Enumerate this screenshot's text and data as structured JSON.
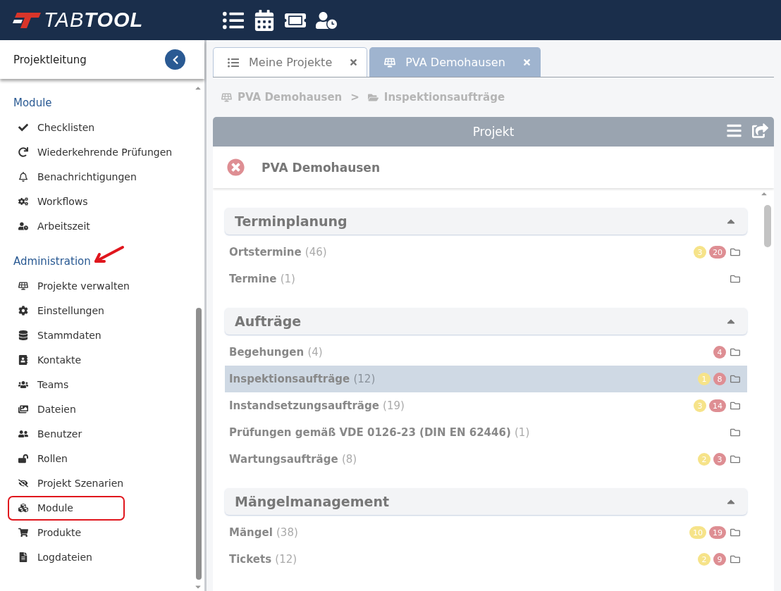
{
  "header": {
    "logo": "TAB**TOOL**"
  },
  "sidebar": {
    "title": "Projektleitung",
    "sections": [
      {
        "title": "Module",
        "annotation_arrow": false,
        "items": [
          {
            "label": "Checklisten",
            "highlighted": false
          },
          {
            "label": "Wiederkehrende Prüfungen",
            "highlighted": false
          },
          {
            "label": "Benachrichtigungen",
            "highlighted": false
          },
          {
            "label": "Workflows",
            "highlighted": false
          },
          {
            "label": "Arbeitszeit",
            "highlighted": false
          }
        ]
      },
      {
        "title": "Administration",
        "annotation_arrow": true,
        "items": [
          {
            "label": "Projekte verwalten",
            "highlighted": false
          },
          {
            "label": "Einstellungen",
            "highlighted": false
          },
          {
            "label": "Stammdaten",
            "highlighted": false
          },
          {
            "label": "Kontakte",
            "highlighted": false
          },
          {
            "label": "Teams",
            "highlighted": false
          },
          {
            "label": "Dateien",
            "highlighted": false
          },
          {
            "label": "Benutzer",
            "highlighted": false
          },
          {
            "label": "Rollen",
            "highlighted": false
          },
          {
            "label": "Projekt Szenarien",
            "highlighted": false
          },
          {
            "label": "Module",
            "highlighted": true
          },
          {
            "label": "Produkte",
            "highlighted": false
          },
          {
            "label": "Logdateien",
            "highlighted": false
          }
        ]
      }
    ]
  },
  "tabs": [
    {
      "label": "Meine Projekte",
      "selected": false
    },
    {
      "label": "PVA Demohausen",
      "selected": true
    }
  ],
  "breadcrumb": [
    "PVA Demohausen",
    "Inspektionsaufträge"
  ],
  "breadcrumb_separator": ">",
  "panel": {
    "title": "Projekt",
    "project_name": "PVA Demohausen",
    "sections": [
      {
        "title": "Terminplanung",
        "expanded": true,
        "rows": [
          {
            "name": "Ortstermine",
            "count": "(46)",
            "selected": false,
            "badges": [
              {
                "text": "3",
                "color": "#f6e389"
              },
              {
                "text": "20",
                "color": "#de8e93"
              }
            ]
          },
          {
            "name": "Termine",
            "count": "(1)",
            "selected": false,
            "badges": []
          }
        ]
      },
      {
        "title": "Aufträge",
        "expanded": true,
        "rows": [
          {
            "name": "Begehungen",
            "count": "(4)",
            "selected": false,
            "badges": [
              {
                "text": "4",
                "color": "#de8e93"
              }
            ]
          },
          {
            "name": "Inspektionsaufträge",
            "count": "(12)",
            "selected": true,
            "badges": [
              {
                "text": "1",
                "color": "#f6e389"
              },
              {
                "text": "8",
                "color": "#de8e93"
              }
            ]
          },
          {
            "name": "Instandsetzungsaufträge",
            "count": "(19)",
            "selected": false,
            "badges": [
              {
                "text": "3",
                "color": "#f6e389"
              },
              {
                "text": "14",
                "color": "#de8e93"
              }
            ]
          },
          {
            "name": "Prüfungen gemäß VDE 0126-23 (DIN EN 62446)",
            "count": "(1)",
            "selected": false,
            "badges": []
          },
          {
            "name": "Wartungsaufträge",
            "count": "(8)",
            "selected": false,
            "badges": [
              {
                "text": "2",
                "color": "#f6e389"
              },
              {
                "text": "3",
                "color": "#de8e93"
              }
            ]
          }
        ]
      },
      {
        "title": "Mängelmanagement",
        "expanded": true,
        "rows": [
          {
            "name": "Mängel",
            "count": "(38)",
            "selected": false,
            "badges": [
              {
                "text": "10",
                "color": "#f6e389"
              },
              {
                "text": "19",
                "color": "#de8e93"
              }
            ]
          },
          {
            "name": "Tickets",
            "count": "(12)",
            "selected": false,
            "badges": [
              {
                "text": "2",
                "color": "#f6e389"
              },
              {
                "text": "9",
                "color": "#de8e93"
              }
            ]
          }
        ]
      }
    ]
  }
}
